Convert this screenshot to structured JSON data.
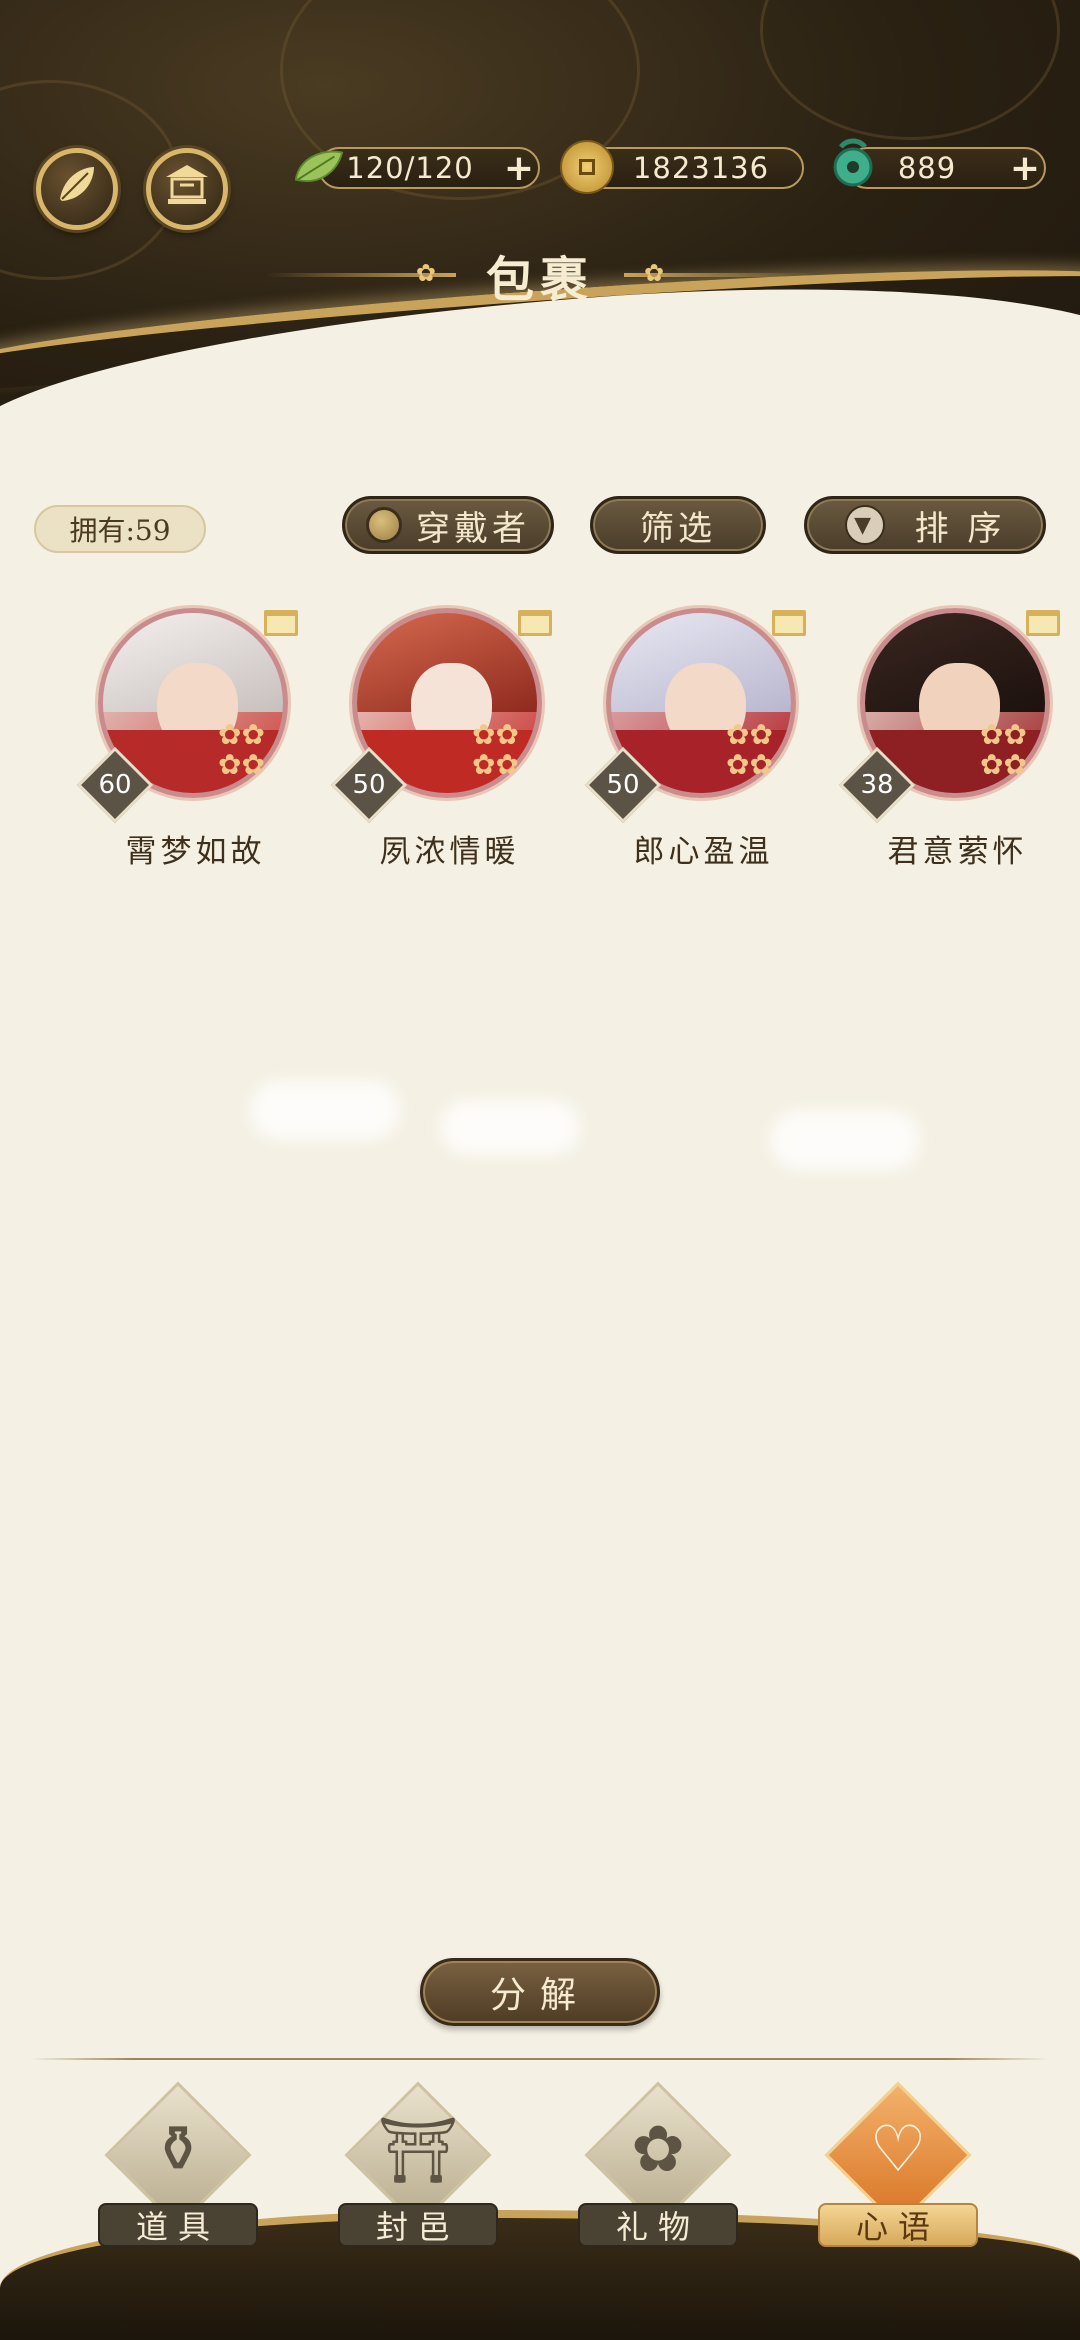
{
  "header": {
    "title": "包裹",
    "stamina": "120/120",
    "coins": "1823136",
    "jade": "889"
  },
  "toolbar": {
    "owned": "拥有:59",
    "wearer_label": "穿戴者",
    "filter_label": "筛选",
    "sort_label": "排 序"
  },
  "items": [
    {
      "name": "霄梦如故",
      "level": "60"
    },
    {
      "name": "夙浓情暖",
      "level": "50"
    },
    {
      "name": "郎心盈温",
      "level": "50"
    },
    {
      "name": "君意萦怀",
      "level": "38"
    }
  ],
  "actions": {
    "decompose_label": "分解"
  },
  "bottom_nav": {
    "tabs": [
      {
        "label": "道具",
        "icon": "vase-icon"
      },
      {
        "label": "封邑",
        "icon": "palace-icon"
      },
      {
        "label": "礼物",
        "icon": "fan-icon"
      },
      {
        "label": "心语",
        "icon": "heart-icon",
        "active": true
      }
    ]
  },
  "colors": {
    "header_bg": "#2a2113",
    "gold": "#c9a35a",
    "page_bg": "#f4f0e3",
    "button_brown": "#5a4a33",
    "active_tab": "#d87324"
  }
}
